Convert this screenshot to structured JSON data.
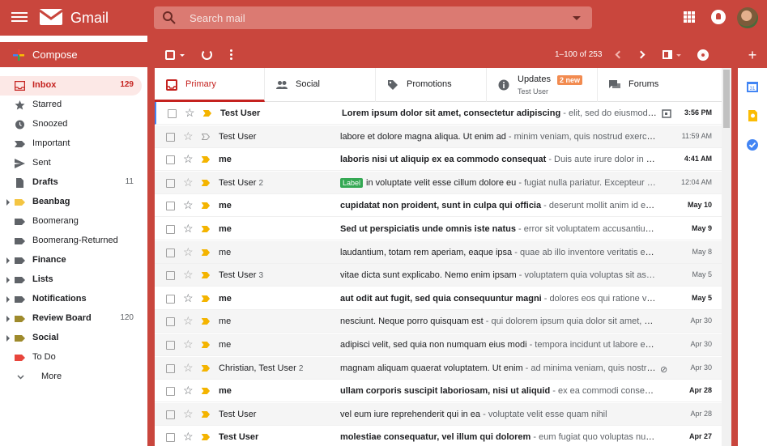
{
  "app": {
    "name": "Gmail"
  },
  "search": {
    "placeholder": "Search mail"
  },
  "sidebar": {
    "compose_label": "Compose",
    "items": [
      {
        "label": "Inbox",
        "count": "129",
        "icon": "inbox-icon",
        "active": true
      },
      {
        "label": "Starred",
        "count": "",
        "icon": "star-icon"
      },
      {
        "label": "Snoozed",
        "count": "",
        "icon": "clock-icon"
      },
      {
        "label": "Important",
        "count": "",
        "icon": "important-icon"
      },
      {
        "label": "Sent",
        "count": "",
        "icon": "send-icon"
      },
      {
        "label": "Drafts",
        "count": "11",
        "icon": "draft-icon"
      },
      {
        "label": "Beanbag",
        "count": "",
        "icon": "label-icon",
        "color": "#f4c542"
      },
      {
        "label": "Boomerang",
        "count": "",
        "icon": "label-icon"
      },
      {
        "label": "Boomerang-Returned",
        "count": "",
        "icon": "label-icon"
      },
      {
        "label": "Finance",
        "count": "",
        "icon": "label-icon"
      },
      {
        "label": "Lists",
        "count": "",
        "icon": "label-icon"
      },
      {
        "label": "Notifications",
        "count": "",
        "icon": "label-icon"
      },
      {
        "label": "Review Board",
        "count": "120",
        "icon": "label-icon",
        "color": "#9e8a2c"
      },
      {
        "label": "Social",
        "count": "",
        "icon": "label-icon",
        "color": "#9e8a2c"
      },
      {
        "label": "To Do",
        "count": "",
        "icon": "label-icon",
        "color": "#e8453c"
      }
    ],
    "more_label": "More"
  },
  "toolbar": {
    "pager": "1–100 of 253"
  },
  "tabs": [
    {
      "label": "Primary",
      "icon": "inbox-icon"
    },
    {
      "label": "Social",
      "icon": "people-icon"
    },
    {
      "label": "Promotions",
      "icon": "tag-icon"
    },
    {
      "label": "Updates",
      "badge": "2 new",
      "sub": "Test User",
      "icon": "info-icon"
    },
    {
      "label": "Forums",
      "icon": "forum-icon"
    }
  ],
  "emails": [
    {
      "sender": "Test User",
      "count": "",
      "subject": "Lorem ipsum dolor sit amet, consectetur adipiscing",
      "snippet": " - elit, sed do eiusmod tem…",
      "date": "3:56 PM",
      "unread": true,
      "important": true
    },
    {
      "sender": "Test User",
      "count": "",
      "subject": "labore et dolore magna aliqua. Ut enim ad",
      "snippet": " - minim veniam, quis nostrud exercit…",
      "date": "11:59 AM",
      "unread": false,
      "important": false
    },
    {
      "sender": "me",
      "count": "",
      "subject": "laboris nisi ut aliquip ex ea commodo consequat",
      "snippet": " - Duis aute irure dolor in repr…",
      "date": "4:41 AM",
      "unread": true,
      "important": true
    },
    {
      "sender": "Test User",
      "count": "2",
      "label": "Label",
      "subject": "in voluptate velit esse cillum dolore eu",
      "snippet": " - fugiat nulla pariatur. Excepteur …",
      "date": "12:04 AM",
      "unread": false,
      "important": true
    },
    {
      "sender": "me",
      "count": "",
      "subject": "cupidatat non proident, sunt in culpa qui officia",
      "snippet": " - deserunt mollit anim id est la…",
      "date": "May 10",
      "unread": true,
      "important": true
    },
    {
      "sender": "me",
      "count": "",
      "subject": "Sed ut perspiciatis unde omnis iste natus",
      "snippet": " - error sit voluptatem accusantium d…",
      "date": "May 9",
      "unread": true,
      "important": true
    },
    {
      "sender": "me",
      "count": "",
      "subject": "laudantium, totam rem aperiam, eaque ipsa",
      "snippet": " - quae ab illo inventore veritatis et …",
      "date": "May 8",
      "unread": false,
      "important": true
    },
    {
      "sender": "Test User",
      "count": "3",
      "subject": "vitae dicta sunt explicabo. Nemo enim ipsam",
      "snippet": " - voluptatem quia voluptas sit as…",
      "date": "May 5",
      "unread": false,
      "important": true
    },
    {
      "sender": "me",
      "count": "",
      "subject": "aut odit aut fugit, sed quia consequuntur magni",
      "snippet": " - dolores eos qui ratione volup…",
      "date": "May 5",
      "unread": true,
      "important": true
    },
    {
      "sender": "me",
      "count": "",
      "subject": "nesciunt. Neque porro quisquam est",
      "snippet": " - qui dolorem ipsum quia dolor sit amet, c…",
      "date": "Apr 30",
      "unread": false,
      "important": true
    },
    {
      "sender": "me",
      "count": "",
      "subject": "adipisci velit, sed quia non numquam eius modi",
      "snippet": " - tempora incidunt ut labore et …",
      "date": "Apr 30",
      "unread": false,
      "important": true
    },
    {
      "sender": "Christian, Test User",
      "count": "2",
      "subject": "magnam aliquam quaerat voluptatem. Ut enim",
      "snippet": " - ad minima veniam, quis nostru…",
      "date": "Apr 30",
      "unread": false,
      "important": true,
      "attachment": true
    },
    {
      "sender": "me",
      "count": "",
      "subject": "ullam corporis suscipit laboriosam, nisi ut aliquid",
      "snippet": " - ex ea commodi consequatur…",
      "date": "Apr 28",
      "unread": true,
      "important": true
    },
    {
      "sender": "Test User",
      "count": "",
      "subject": "vel eum iure reprehenderit qui in ea",
      "snippet": " - voluptate velit esse quam nihil",
      "date": "Apr 28",
      "unread": false,
      "important": true
    },
    {
      "sender": "Test User",
      "count": "",
      "subject": "molestiae consequatur, vel illum qui dolorem",
      "snippet": " - eum fugiat quo voluptas nulla…",
      "date": "Apr 27",
      "unread": true,
      "important": true
    }
  ],
  "rightbar": {
    "plus": "+",
    "calendar_text": "31"
  },
  "colors": {
    "brand": "#c9463d",
    "important": "#f4b400",
    "label_green": "#34a853"
  }
}
